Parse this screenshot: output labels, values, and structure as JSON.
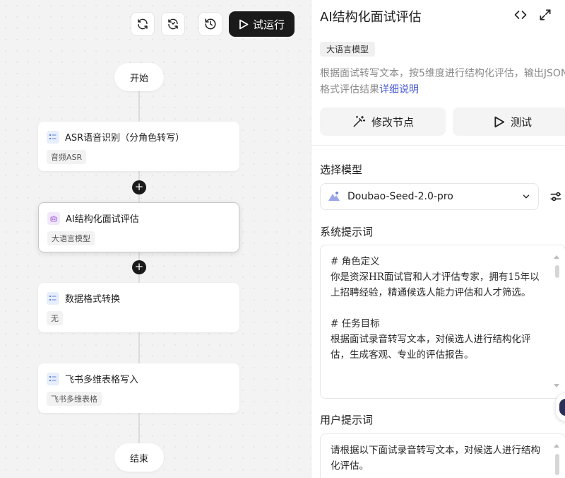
{
  "toolbar": {
    "refresh_icon": "refresh-icon",
    "sync_icon": "sync-icon",
    "history_icon": "history-icon",
    "run_label": "试运行"
  },
  "flow": {
    "start_label": "开始",
    "end_label": "结束",
    "nodes": [
      {
        "title": "ASR语音识别（分角色转写）",
        "tag": "音频ASR",
        "icon": "list-icon"
      },
      {
        "title": "AI结构化面试评估",
        "tag": "大语言模型",
        "icon": "robot-icon",
        "selected": true
      },
      {
        "title": "数据格式转换",
        "tag": "无",
        "icon": "list-icon"
      },
      {
        "title": "飞书多维表格写入",
        "tag": "飞书多维表格",
        "icon": "list-icon"
      }
    ],
    "add_symbol": "+"
  },
  "panel": {
    "title": "AI结构化面试评估",
    "badge": "大语言模型",
    "description": "根据面试转写文本，按5维度进行结构化评估，输出JSON格式评估结果",
    "description_link": "详细说明",
    "edit_node_label": "修改节点",
    "test_label": "测试",
    "model_section_label": "选择模型",
    "model_value": "Doubao-Seed-2.0-pro",
    "system_prompt_label": "系统提示词",
    "system_prompt": "# 角色定义\n你是资深HR面试官和人才评估专家，拥有15年以上招聘经验，精通候选人能力评估和人才筛选。\n\n# 任务目标\n根据面试录音转写文本，对候选人进行结构化评估，生成客观、专业的评估报告。",
    "user_prompt_label": "用户提示词",
    "user_prompt": "请根据以下面试录音转写文本，对候选人进行结构化评估。"
  },
  "colors": {
    "accent_link": "#4a5bd6",
    "run_button_bg": "#1a1a1a",
    "canvas_bg": "#f3f3f3"
  }
}
